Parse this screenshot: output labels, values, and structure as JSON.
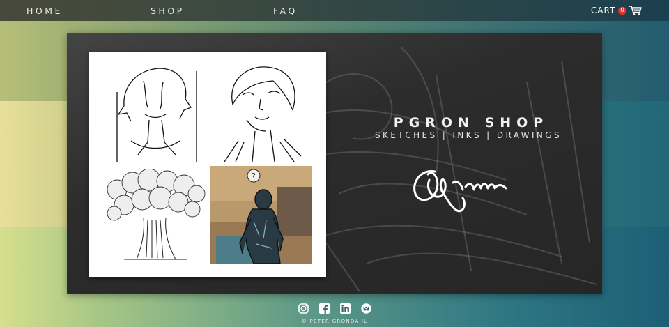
{
  "nav": {
    "home_label": "HOME",
    "shop_label": "SHOP",
    "faq_label": "FAQ",
    "cart_label": "CART",
    "cart_count": "0"
  },
  "hero": {
    "title": "PGRON SHOP",
    "subtitle": "SKETCHES | INKS | DRAWINGS"
  },
  "gallery": {
    "items": [
      {
        "icon": "line-sketch-figure"
      },
      {
        "icon": "line-sketch-woman-face"
      },
      {
        "icon": "ink-mushroom-cloud"
      },
      {
        "icon": "colored-figure-painting"
      }
    ]
  },
  "social": {
    "icons": [
      "instagram-icon",
      "facebook-icon",
      "linkedin-icon",
      "email-icon"
    ]
  },
  "footer": {
    "copyright": "© PETER GRONDAHL"
  },
  "colors": {
    "panel": "#2c2c2c",
    "badge": "#dd3333",
    "text": "#f2f2f2"
  }
}
